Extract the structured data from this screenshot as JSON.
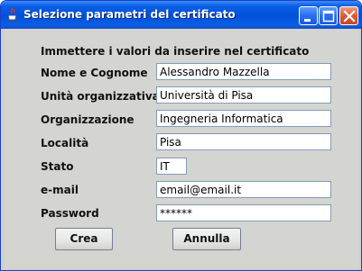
{
  "window": {
    "title": "Selezione parametri del certificato"
  },
  "form": {
    "heading": "Immettere i valori da inserire nel certificato",
    "fields": [
      {
        "label": "Nome e Cognome",
        "value": "Alessandro Mazzella"
      },
      {
        "label": "Unità organizzativa",
        "value": "Università di Pisa"
      },
      {
        "label": "Organizzazione",
        "value": "Ingegneria Informatica"
      },
      {
        "label": "Località",
        "value": "Pisa"
      },
      {
        "label": "Stato",
        "value": "IT"
      },
      {
        "label": "e-mail",
        "value": "email@email.it"
      },
      {
        "label": "Password",
        "value": "******"
      }
    ]
  },
  "buttons": {
    "create": "Crea",
    "cancel": "Annulla"
  },
  "icons": {
    "app": "java-cup-icon",
    "minimize": "minimize-icon",
    "maximize": "maximize-icon",
    "close": "close-icon"
  },
  "colors": {
    "titlebar": "#0150d8",
    "close_button": "#de5a32",
    "background": "#d4d4d0",
    "field_border": "#7f9db9"
  }
}
